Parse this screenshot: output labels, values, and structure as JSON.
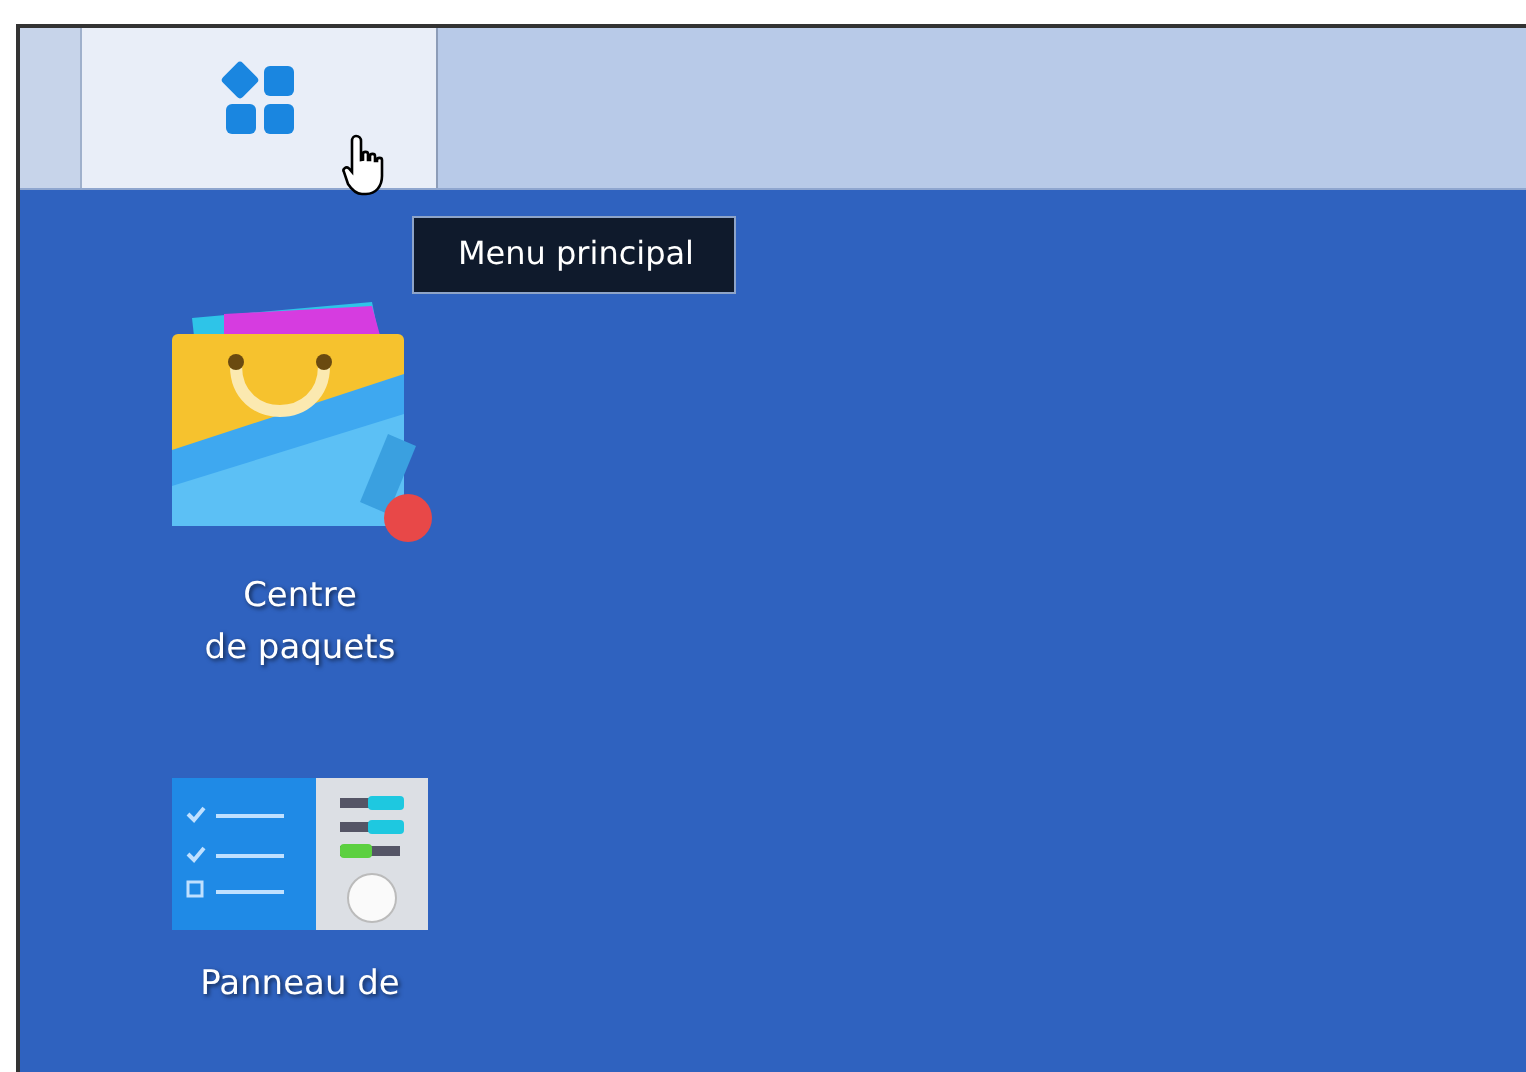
{
  "taskbar": {
    "main_menu_button": {
      "hovered": true
    }
  },
  "tooltip": {
    "text": "Menu principal"
  },
  "desktop_icons": [
    {
      "kind": "package-center",
      "label": "Centre\nde paquets"
    },
    {
      "kind": "control-panel",
      "label": "Panneau de"
    }
  ]
}
